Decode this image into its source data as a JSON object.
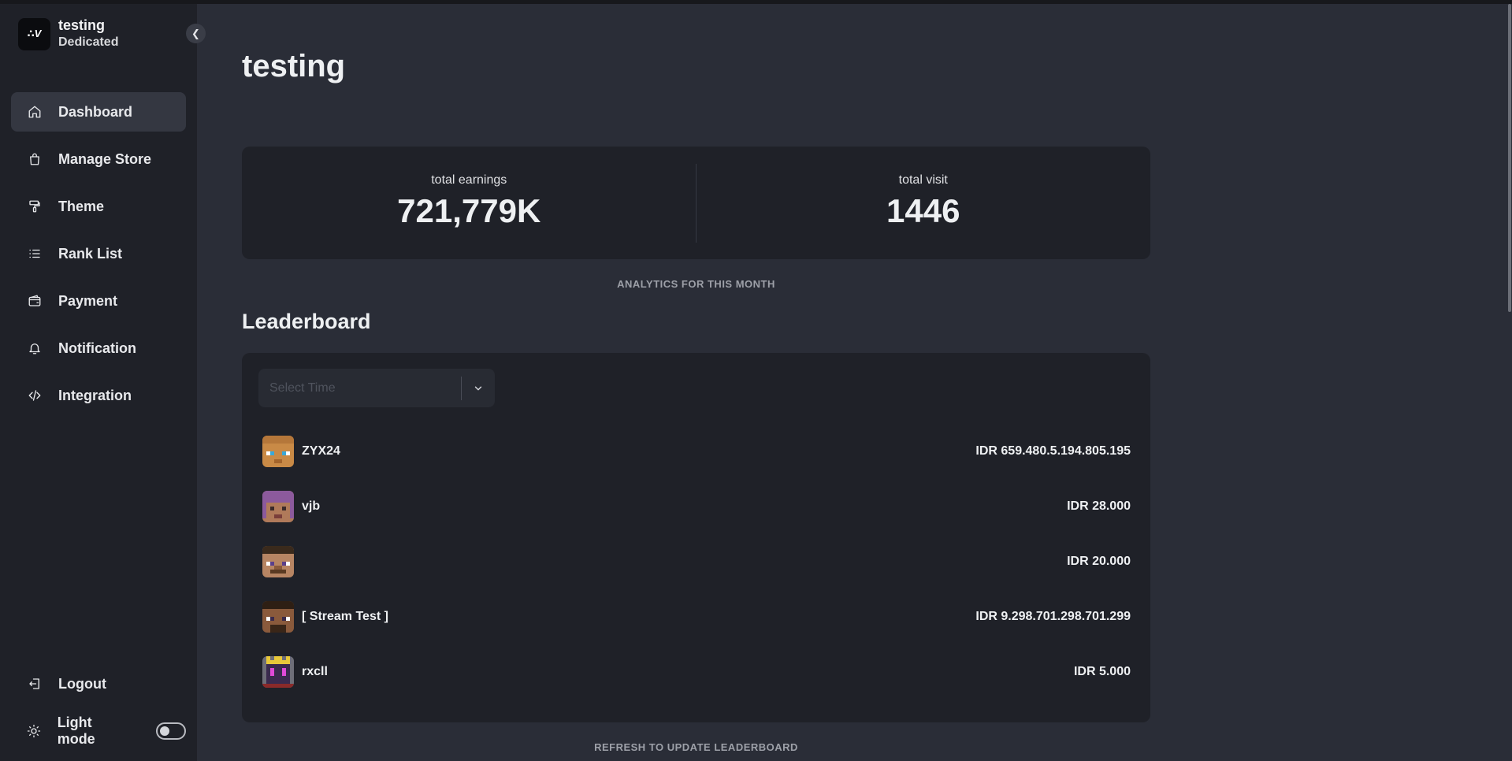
{
  "sidebar": {
    "brand": {
      "name": "testing",
      "plan": "Dedicated",
      "logo_text": "∴V"
    },
    "nav": [
      {
        "label": "Dashboard",
        "icon": "home-icon",
        "active": true
      },
      {
        "label": "Manage Store",
        "icon": "shopping-bag-icon",
        "active": false
      },
      {
        "label": "Theme",
        "icon": "paint-roller-icon",
        "active": false
      },
      {
        "label": "Rank List",
        "icon": "list-icon",
        "active": false
      },
      {
        "label": "Payment",
        "icon": "wallet-icon",
        "active": false
      },
      {
        "label": "Notification",
        "icon": "bell-icon",
        "active": false
      },
      {
        "label": "Integration",
        "icon": "code-icon",
        "active": false
      }
    ],
    "logout_label": "Logout",
    "light_mode_label": "Light mode",
    "light_mode_on": false
  },
  "main": {
    "title": "testing",
    "stats": {
      "earnings_label": "total earnings",
      "earnings_value": "721,779K",
      "visit_label": "total visit",
      "visit_value": "1446"
    },
    "analytics_caption": "ANALYTICS FOR THIS MONTH",
    "leaderboard": {
      "title": "Leaderboard",
      "select_placeholder": "Select Time",
      "rows": [
        {
          "name": "ZYX24",
          "amount": "IDR 659.480.5.194.805.195"
        },
        {
          "name": "vjb",
          "amount": "IDR 28.000"
        },
        {
          "name": "",
          "amount": "IDR 20.000"
        },
        {
          "name": "[ Stream Test ]",
          "amount": "IDR 9.298.701.298.701.299"
        },
        {
          "name": "rxcll",
          "amount": "IDR 5.000"
        }
      ],
      "refresh_caption": "REFRESH TO UPDATE LEADERBOARD"
    }
  }
}
